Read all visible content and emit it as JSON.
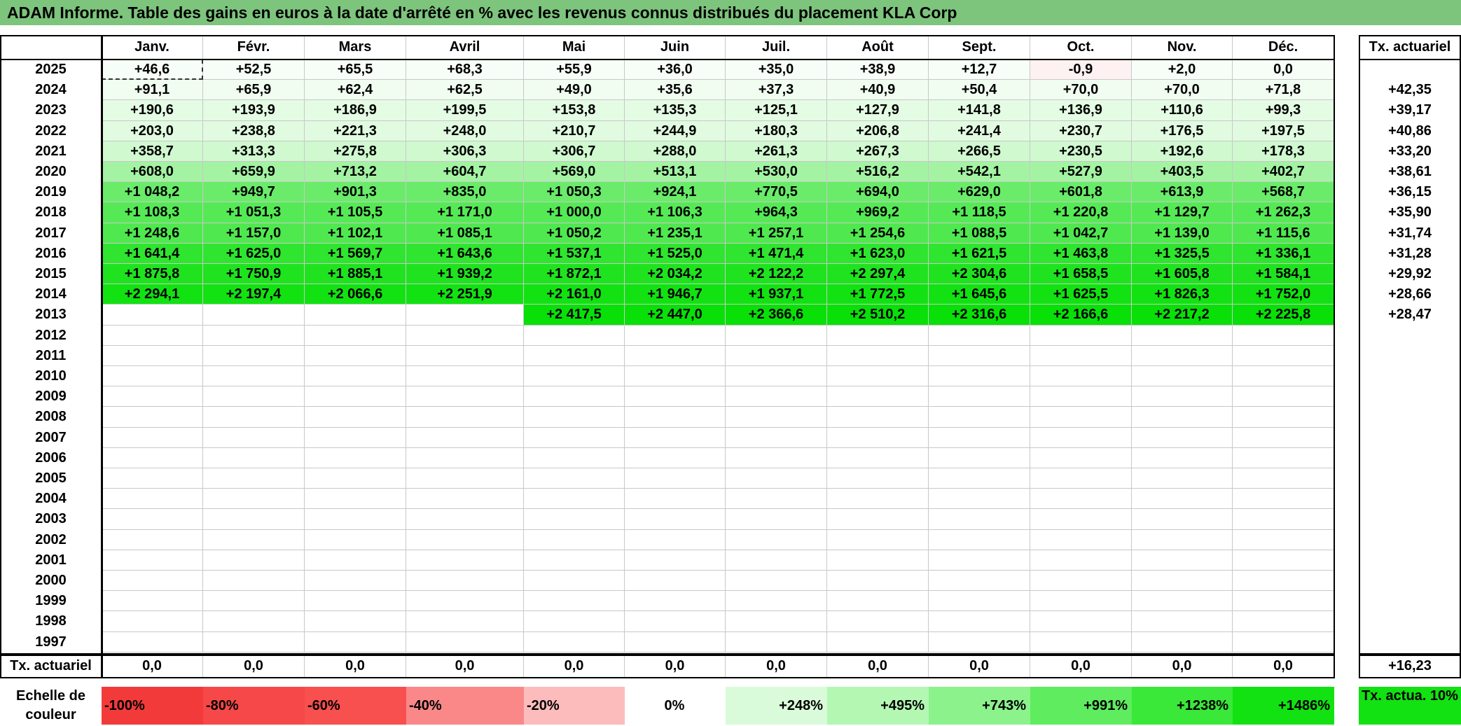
{
  "title": "ADAM Informe. Table des gains en euros à la date d'arrêté en % avec les revenus connus distribués du placement KLA Corp",
  "months": [
    "Janv.",
    "Févr.",
    "Mars",
    "Avril",
    "Mai",
    "Juin",
    "Juil.",
    "Août",
    "Sept.",
    "Oct.",
    "Nov.",
    "Déc."
  ],
  "rate_header": "Tx. actuariel",
  "rows": [
    {
      "year": "2025",
      "values": [
        "+46,6",
        "+52,5",
        "+65,5",
        "+68,3",
        "+55,9",
        "+36,0",
        "+35,0",
        "+38,9",
        "+12,7",
        "-0,9",
        "+2,0",
        "0,0"
      ],
      "rate": ""
    },
    {
      "year": "2024",
      "values": [
        "+91,1",
        "+65,9",
        "+62,4",
        "+62,5",
        "+49,0",
        "+35,6",
        "+37,3",
        "+40,9",
        "+50,4",
        "+70,0",
        "+70,0",
        "+71,8"
      ],
      "rate": "+42,35"
    },
    {
      "year": "2023",
      "values": [
        "+190,6",
        "+193,9",
        "+186,9",
        "+199,5",
        "+153,8",
        "+135,3",
        "+125,1",
        "+127,9",
        "+141,8",
        "+136,9",
        "+110,6",
        "+99,3"
      ],
      "rate": "+39,17"
    },
    {
      "year": "2022",
      "values": [
        "+203,0",
        "+238,8",
        "+221,3",
        "+248,0",
        "+210,7",
        "+244,9",
        "+180,3",
        "+206,8",
        "+241,4",
        "+230,7",
        "+176,5",
        "+197,5"
      ],
      "rate": "+40,86"
    },
    {
      "year": "2021",
      "values": [
        "+358,7",
        "+313,3",
        "+275,8",
        "+306,3",
        "+306,7",
        "+288,0",
        "+261,3",
        "+267,3",
        "+266,5",
        "+230,5",
        "+192,6",
        "+178,3"
      ],
      "rate": "+33,20"
    },
    {
      "year": "2020",
      "values": [
        "+608,0",
        "+659,9",
        "+713,2",
        "+604,7",
        "+569,0",
        "+513,1",
        "+530,0",
        "+516,2",
        "+542,1",
        "+527,9",
        "+403,5",
        "+402,7"
      ],
      "rate": "+38,61"
    },
    {
      "year": "2019",
      "values": [
        "+1 048,2",
        "+949,7",
        "+901,3",
        "+835,0",
        "+1 050,3",
        "+924,1",
        "+770,5",
        "+694,0",
        "+629,0",
        "+601,8",
        "+613,9",
        "+568,7"
      ],
      "rate": "+36,15"
    },
    {
      "year": "2018",
      "values": [
        "+1 108,3",
        "+1 051,3",
        "+1 105,5",
        "+1 171,0",
        "+1 000,0",
        "+1 106,3",
        "+964,3",
        "+969,2",
        "+1 118,5",
        "+1 220,8",
        "+1 129,7",
        "+1 262,3"
      ],
      "rate": "+35,90"
    },
    {
      "year": "2017",
      "values": [
        "+1 248,6",
        "+1 157,0",
        "+1 102,1",
        "+1 085,1",
        "+1 050,2",
        "+1 235,1",
        "+1 257,1",
        "+1 254,6",
        "+1 088,5",
        "+1 042,7",
        "+1 139,0",
        "+1 115,6"
      ],
      "rate": "+31,74"
    },
    {
      "year": "2016",
      "values": [
        "+1 641,4",
        "+1 625,0",
        "+1 569,7",
        "+1 643,6",
        "+1 537,1",
        "+1 525,0",
        "+1 471,4",
        "+1 623,0",
        "+1 621,5",
        "+1 463,8",
        "+1 325,5",
        "+1 336,1"
      ],
      "rate": "+31,28"
    },
    {
      "year": "2015",
      "values": [
        "+1 875,8",
        "+1 750,9",
        "+1 885,1",
        "+1 939,2",
        "+1 872,1",
        "+2 034,2",
        "+2 122,2",
        "+2 297,4",
        "+2 304,6",
        "+1 658,5",
        "+1 605,8",
        "+1 584,1"
      ],
      "rate": "+29,92"
    },
    {
      "year": "2014",
      "values": [
        "+2 294,1",
        "+2 197,4",
        "+2 066,6",
        "+2 251,9",
        "+2 161,0",
        "+1 946,7",
        "+1 937,1",
        "+1 772,5",
        "+1 645,6",
        "+1 625,5",
        "+1 826,3",
        "+1 752,0"
      ],
      "rate": "+28,66"
    },
    {
      "year": "2013",
      "values": [
        "",
        "",
        "",
        "",
        "+2 417,5",
        "+2 447,0",
        "+2 366,6",
        "+2 510,2",
        "+2 316,6",
        "+2 166,6",
        "+2 217,2",
        "+2 225,8"
      ],
      "rate": "+28,47"
    },
    {
      "year": "2012",
      "values": [
        "",
        "",
        "",
        "",
        "",
        "",
        "",
        "",
        "",
        "",
        "",
        ""
      ],
      "rate": ""
    },
    {
      "year": "2011",
      "values": [
        "",
        "",
        "",
        "",
        "",
        "",
        "",
        "",
        "",
        "",
        "",
        ""
      ],
      "rate": ""
    },
    {
      "year": "2010",
      "values": [
        "",
        "",
        "",
        "",
        "",
        "",
        "",
        "",
        "",
        "",
        "",
        ""
      ],
      "rate": ""
    },
    {
      "year": "2009",
      "values": [
        "",
        "",
        "",
        "",
        "",
        "",
        "",
        "",
        "",
        "",
        "",
        ""
      ],
      "rate": ""
    },
    {
      "year": "2008",
      "values": [
        "",
        "",
        "",
        "",
        "",
        "",
        "",
        "",
        "",
        "",
        "",
        ""
      ],
      "rate": ""
    },
    {
      "year": "2007",
      "values": [
        "",
        "",
        "",
        "",
        "",
        "",
        "",
        "",
        "",
        "",
        "",
        ""
      ],
      "rate": ""
    },
    {
      "year": "2006",
      "values": [
        "",
        "",
        "",
        "",
        "",
        "",
        "",
        "",
        "",
        "",
        "",
        ""
      ],
      "rate": ""
    },
    {
      "year": "2005",
      "values": [
        "",
        "",
        "",
        "",
        "",
        "",
        "",
        "",
        "",
        "",
        "",
        ""
      ],
      "rate": ""
    },
    {
      "year": "2004",
      "values": [
        "",
        "",
        "",
        "",
        "",
        "",
        "",
        "",
        "",
        "",
        "",
        ""
      ],
      "rate": ""
    },
    {
      "year": "2003",
      "values": [
        "",
        "",
        "",
        "",
        "",
        "",
        "",
        "",
        "",
        "",
        "",
        ""
      ],
      "rate": ""
    },
    {
      "year": "2002",
      "values": [
        "",
        "",
        "",
        "",
        "",
        "",
        "",
        "",
        "",
        "",
        "",
        ""
      ],
      "rate": ""
    },
    {
      "year": "2001",
      "values": [
        "",
        "",
        "",
        "",
        "",
        "",
        "",
        "",
        "",
        "",
        "",
        ""
      ],
      "rate": ""
    },
    {
      "year": "2000",
      "values": [
        "",
        "",
        "",
        "",
        "",
        "",
        "",
        "",
        "",
        "",
        "",
        ""
      ],
      "rate": ""
    },
    {
      "year": "1999",
      "values": [
        "",
        "",
        "",
        "",
        "",
        "",
        "",
        "",
        "",
        "",
        "",
        ""
      ],
      "rate": ""
    },
    {
      "year": "1998",
      "values": [
        "",
        "",
        "",
        "",
        "",
        "",
        "",
        "",
        "",
        "",
        "",
        ""
      ],
      "rate": ""
    },
    {
      "year": "1997",
      "values": [
        "",
        "",
        "",
        "",
        "",
        "",
        "",
        "",
        "",
        "",
        "",
        ""
      ],
      "rate": ""
    }
  ],
  "footer": {
    "label": "Tx. actuariel",
    "values": [
      "0,0",
      "0,0",
      "0,0",
      "0,0",
      "0,0",
      "0,0",
      "0,0",
      "0,0",
      "0,0",
      "0,0",
      "0,0",
      "0,0"
    ],
    "rate": "+16,23"
  },
  "scale": {
    "label": "Echelle de couleur",
    "items": [
      "-100%",
      "-80%",
      "-60%",
      "-40%",
      "-20%",
      "0%",
      "+248%",
      "+495%",
      "+743%",
      "+991%",
      "+1238%",
      "+1486%"
    ],
    "colors": [
      "#f33a3a",
      "#f64848",
      "#f84f4f",
      "#fa8888",
      "#fcbcbc",
      "#ffffff",
      "#d9fbd9",
      "#b3f7b3",
      "#8cf28c",
      "#5fec5f",
      "#39e839",
      "#12e212"
    ],
    "rate_label": "Tx. actua. 10%",
    "rate_color": "#12e212"
  },
  "row_colors": {
    "2025": "#f7fef7",
    "2024": "#f1fdf1",
    "2023": "#e4fbe4",
    "2022": "#e1fbe1",
    "2021": "#d0f9d0",
    "2020": "#a3f3a3",
    "2019": "#6aec6a",
    "2018": "#55ea55",
    "2017": "#4fe94f",
    "2016": "#2fe52f",
    "2015": "#1fe31f",
    "2014": "#12e212",
    "2013": "#08e008"
  },
  "neg_color": "#fef1f1"
}
